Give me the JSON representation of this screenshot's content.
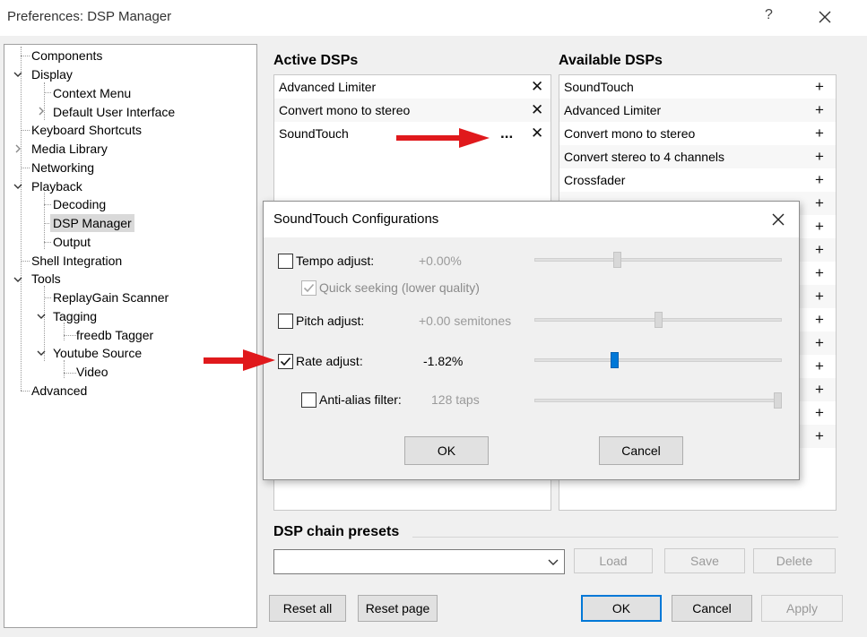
{
  "window": {
    "title": "Preferences: DSP Manager",
    "help_glyph": "?"
  },
  "tree": {
    "items": [
      {
        "label": "Components"
      },
      {
        "label": "Display"
      },
      {
        "label": "Context Menu"
      },
      {
        "label": "Default User Interface"
      },
      {
        "label": "Keyboard Shortcuts"
      },
      {
        "label": "Media Library"
      },
      {
        "label": "Networking"
      },
      {
        "label": "Playback"
      },
      {
        "label": "Decoding"
      },
      {
        "label": "DSP Manager"
      },
      {
        "label": "Output"
      },
      {
        "label": "Shell Integration"
      },
      {
        "label": "Tools"
      },
      {
        "label": "ReplayGain Scanner"
      },
      {
        "label": "Tagging"
      },
      {
        "label": "freedb Tagger"
      },
      {
        "label": "Youtube Source"
      },
      {
        "label": "Video"
      },
      {
        "label": "Advanced"
      }
    ],
    "selected": "DSP Manager"
  },
  "active_dsps": {
    "title": "Active DSPs",
    "items": [
      {
        "label": "Advanced Limiter",
        "remove": "✕"
      },
      {
        "label": "Convert mono to stereo",
        "remove": "✕"
      },
      {
        "label": "SoundTouch",
        "configure": "...",
        "remove": "✕"
      }
    ]
  },
  "available_dsps": {
    "title": "Available DSPs",
    "items": [
      {
        "label": "SoundTouch"
      },
      {
        "label": "Advanced Limiter"
      },
      {
        "label": "Convert mono to stereo"
      },
      {
        "label": "Convert stereo to 4 channels"
      },
      {
        "label": "Crossfader"
      },
      {
        "label": ""
      },
      {
        "label": ""
      },
      {
        "label": ""
      },
      {
        "label": ""
      },
      {
        "label": ""
      },
      {
        "label": ""
      },
      {
        "label": ""
      },
      {
        "label": ""
      },
      {
        "label": ""
      },
      {
        "label": ""
      },
      {
        "label": ""
      }
    ],
    "add_glyph": "+"
  },
  "presets": {
    "title": "DSP chain presets",
    "load": "Load",
    "save": "Save",
    "delete": "Delete"
  },
  "footer": {
    "reset_all": "Reset all",
    "reset_page": "Reset page",
    "ok": "OK",
    "cancel": "Cancel",
    "apply": "Apply"
  },
  "dialog": {
    "title": "SoundTouch Configurations",
    "tempo": {
      "label": "Tempo adjust:",
      "value": "+0.00%",
      "checked": false,
      "level": 0.33
    },
    "quick_seeking": {
      "label": "Quick seeking (lower quality)",
      "checked": true,
      "disabled": true
    },
    "pitch": {
      "label": "Pitch adjust:",
      "value": "+0.00 semitones",
      "checked": false,
      "level": 0.5
    },
    "rate": {
      "label": "Rate adjust:",
      "value": "-1.82%",
      "checked": true,
      "level": 0.32
    },
    "antialias": {
      "label": "Anti-alias filter:",
      "value": "128 taps",
      "checked": false,
      "level": 1.0
    },
    "ok": "OK",
    "cancel": "Cancel"
  },
  "colors": {
    "accent": "#0078d7",
    "annotation_arrow": "#e0191c",
    "selection": "#d9d9d9"
  }
}
